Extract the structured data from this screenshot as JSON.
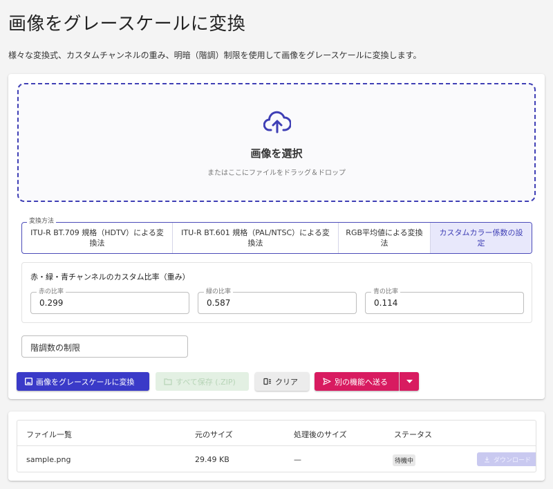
{
  "header": {
    "title": "画像をグレースケールに変換",
    "description": "様々な変換式、カスタムチャンネルの重み、明暗（階調）制限を使用して画像をグレースケールに変換します。"
  },
  "dropzone": {
    "title": "画像を選択",
    "subtitle": "またはここにファイルをドラッグ＆ドロップ",
    "icon": "cloud-upload-icon"
  },
  "method": {
    "legend": "変換方法",
    "options": [
      {
        "label": "ITU-R BT.709 規格（HDTV）による変換法",
        "selected": false
      },
      {
        "label": "ITU-R BT.601 規格（PAL/NTSC）による変換法",
        "selected": false
      },
      {
        "label": "RGB平均値による変換法",
        "selected": false
      },
      {
        "label": "カスタムカラー係数の設定",
        "selected": true
      }
    ]
  },
  "ratios": {
    "title": "赤・緑・青チャンネルのカスタム比率（重み）",
    "red": {
      "label": "赤の比率",
      "value": "0.299"
    },
    "green": {
      "label": "緑の比率",
      "value": "0.587"
    },
    "blue": {
      "label": "青の比率",
      "value": "0.114"
    }
  },
  "levels": {
    "label": "階調数の制限"
  },
  "actions": {
    "convert": "画像をグレースケールに変換",
    "save_all": "すべて保存 (.ZIP)",
    "clear": "クリア",
    "send": "別の機能へ送る"
  },
  "table": {
    "headers": [
      "ファイル一覧",
      "元のサイズ",
      "処理後のサイズ",
      "ステータス"
    ],
    "rows": [
      {
        "name": "sample.png",
        "original_size": "29.49 KB",
        "processed_size": "—",
        "status": "待機中",
        "action": "ダウンロード"
      }
    ]
  },
  "colors": {
    "primary": "#3a3ac8",
    "accent": "#d81b60",
    "disabled_green": "#e3f0e3",
    "selected_bg": "#e8e8fb"
  }
}
